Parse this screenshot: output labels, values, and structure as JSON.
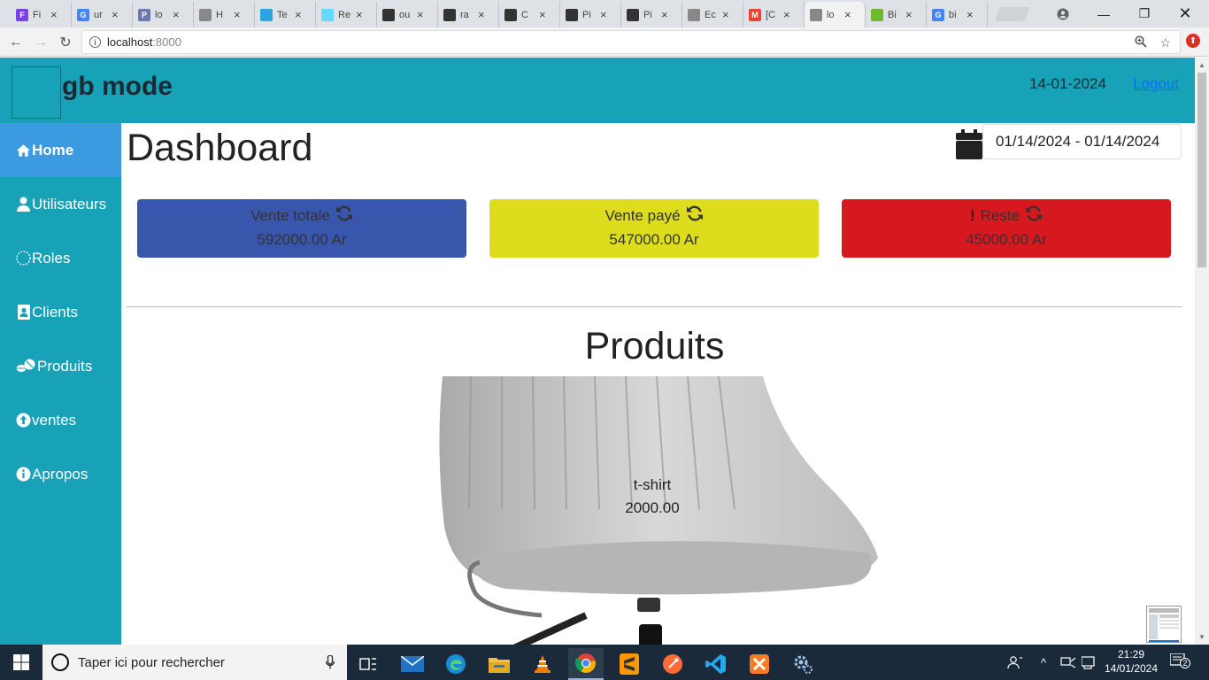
{
  "browser": {
    "tabs": [
      {
        "label": "Fi",
        "color": "#7b3fe4",
        "glyph": "F"
      },
      {
        "label": "ur",
        "color": "#4285f4",
        "glyph": "G"
      },
      {
        "label": "lo",
        "color": "#6c78af",
        "glyph": "P"
      },
      {
        "label": "H",
        "color": "#888888",
        "glyph": ""
      },
      {
        "label": "Te",
        "color": "#2aa5e0",
        "glyph": ""
      },
      {
        "label": "Re",
        "color": "#61dafb",
        "glyph": ""
      },
      {
        "label": "ou",
        "color": "#333333",
        "glyph": ""
      },
      {
        "label": "ra",
        "color": "#333333",
        "glyph": ""
      },
      {
        "label": "C",
        "color": "#333333",
        "glyph": ""
      },
      {
        "label": "Pi",
        "color": "#333333",
        "glyph": ""
      },
      {
        "label": "Pi",
        "color": "#333333",
        "glyph": ""
      },
      {
        "label": "Ec",
        "color": "#888888",
        "glyph": ""
      },
      {
        "label": "[C",
        "color": "#ea4335",
        "glyph": "M"
      },
      {
        "label": "lo",
        "color": "#888888",
        "glyph": ""
      },
      {
        "label": "Bi",
        "color": "#6fba2c",
        "glyph": ""
      },
      {
        "label": "bi",
        "color": "#4285f4",
        "glyph": "G"
      }
    ],
    "active_tab_index": 13,
    "url_host": "localhost",
    "url_port": ":8000"
  },
  "header": {
    "brand": "gb mode",
    "date": "14-01-2024",
    "logout": "Logout"
  },
  "sidebar": {
    "items": [
      {
        "label": "Home",
        "icon": "home-icon",
        "active": true
      },
      {
        "label": "Utilisateurs",
        "icon": "user-icon",
        "active": false
      },
      {
        "label": "Roles",
        "icon": "circle-icon",
        "active": false
      },
      {
        "label": "Clients",
        "icon": "contact-card-icon",
        "active": false
      },
      {
        "label": "Produits",
        "icon": "pills-icon",
        "active": false
      },
      {
        "label": "ventes",
        "icon": "arrow-up-circle-icon",
        "active": false
      },
      {
        "label": "Apropos",
        "icon": "info-icon",
        "active": false
      }
    ]
  },
  "main": {
    "title": "Dashboard",
    "date_range": "01/14/2024 - 01/14/2024",
    "stats": [
      {
        "label": "Vente totale",
        "value": "592000.00 Ar",
        "color": "#3956ad"
      },
      {
        "label": "Vente payé",
        "value": "547000.00 Ar",
        "color": "#dddd1d"
      },
      {
        "label": "Reste",
        "value": "45000.00 Ar",
        "color": "#d6191f"
      }
    ],
    "products_heading": "Produits",
    "products": [
      {
        "name": "t-shirt",
        "price": "2000.00"
      }
    ]
  },
  "taskbar": {
    "search_placeholder": "Taper ici pour rechercher",
    "time": "21:29",
    "date": "14/01/2024",
    "notification_count": "2"
  }
}
